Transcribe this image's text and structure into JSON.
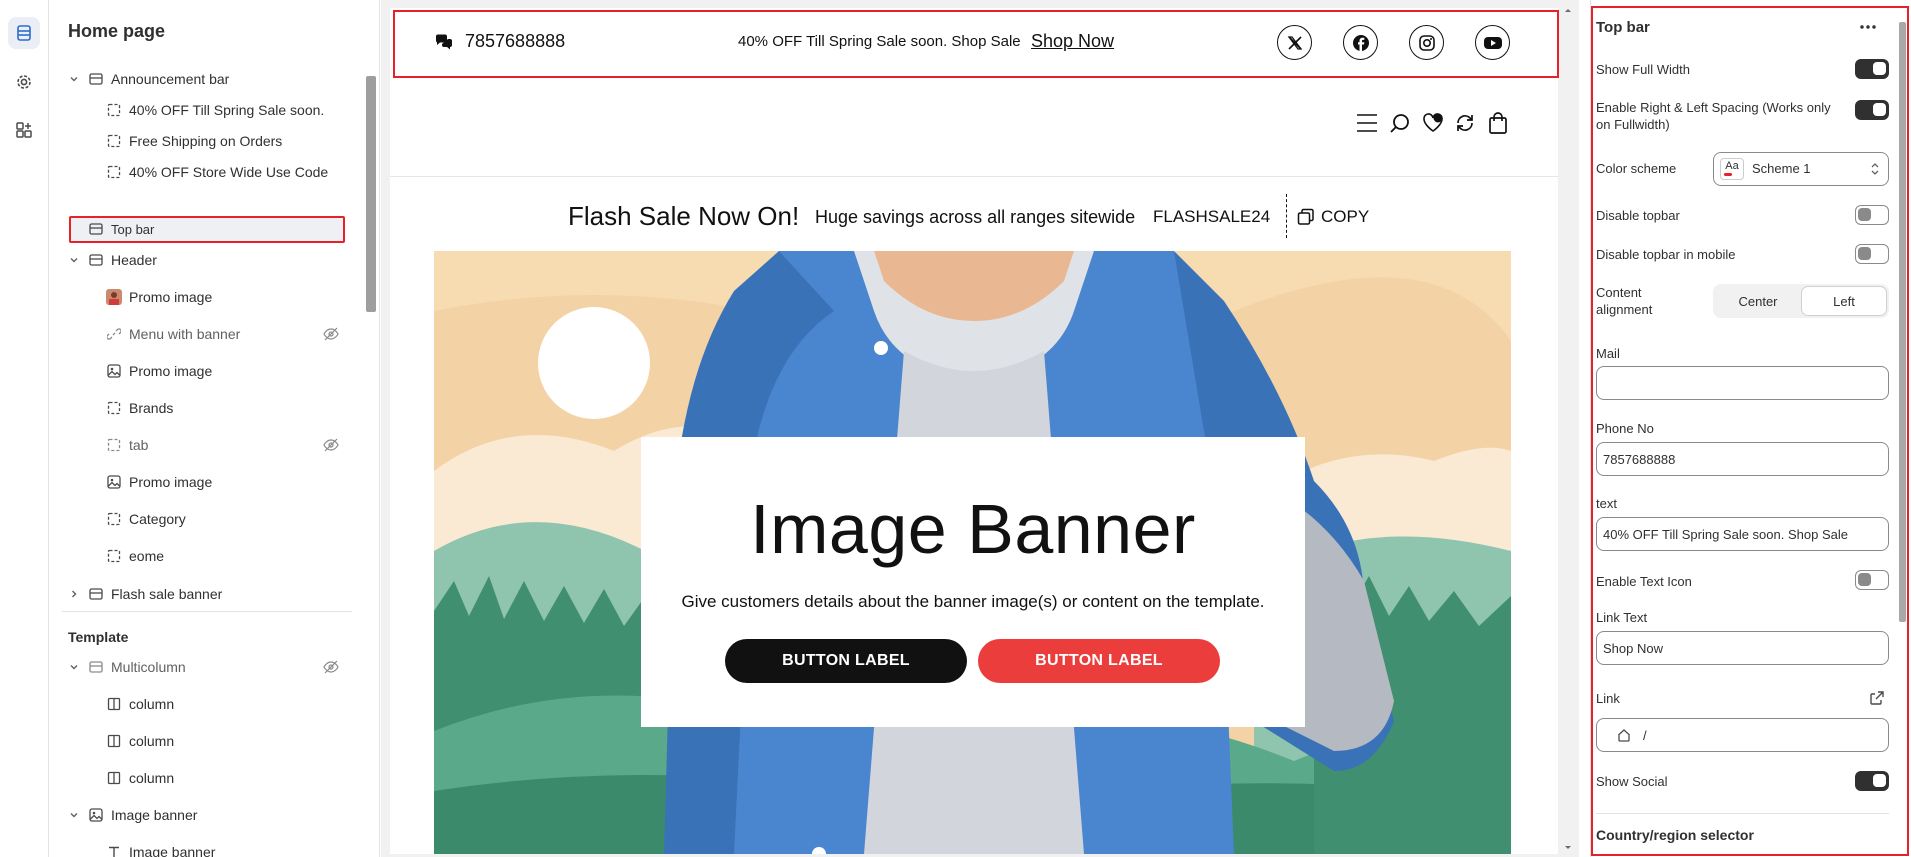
{
  "left_panel": {
    "title": "Home page",
    "items": [
      {
        "label": "Announcement bar"
      },
      {
        "label": "40% OFF Till Spring Sale soon."
      },
      {
        "label": "Free Shipping on Orders"
      },
      {
        "label": "40% OFF Store Wide Use Code"
      },
      {
        "label": "Top bar"
      },
      {
        "label": "Header"
      },
      {
        "label": "Promo image"
      },
      {
        "label": "Menu with banner"
      },
      {
        "label": "Promo image"
      },
      {
        "label": "Brands"
      },
      {
        "label": "tab"
      },
      {
        "label": "Promo image"
      },
      {
        "label": "Category"
      },
      {
        "label": "eome"
      },
      {
        "label": "Flash sale banner"
      }
    ],
    "template_title": "Template",
    "template_items": [
      {
        "label": "Multicolumn"
      },
      {
        "label": "column"
      },
      {
        "label": "column"
      },
      {
        "label": "column"
      },
      {
        "label": "Image banner"
      },
      {
        "label": "Image banner"
      }
    ]
  },
  "preview": {
    "topbar": {
      "phone": "7857688888",
      "text": "40% OFF Till Spring Sale soon. Shop Sale",
      "link": "Shop Now",
      "social": [
        "x-icon",
        "facebook-icon",
        "instagram-icon",
        "youtube-icon"
      ]
    },
    "flash": {
      "title": "Flash Sale Now On!",
      "subtitle": "Huge savings across all ranges sitewide",
      "code": "FLASHSALE24",
      "copy": "COPY"
    },
    "banner": {
      "title": "Image Banner",
      "subtitle": "Give customers details about the banner image(s) or content on the template.",
      "button1": "BUTTON LABEL",
      "button2": "BUTTON LABEL"
    }
  },
  "settings": {
    "title": "Top bar",
    "show_full_width": "Show Full Width",
    "spacing": "Enable Right & Left Spacing (Works only on Fullwidth)",
    "color_scheme": "Color scheme",
    "scheme_value": "Scheme 1",
    "scheme_swatch": "Aa",
    "disable_topbar": "Disable topbar",
    "disable_topbar_mobile": "Disable topbar in mobile",
    "content_alignment": "Content alignment",
    "align_center": "Center",
    "align_left": "Left",
    "mail": "Mail",
    "mail_value": "",
    "phone_label": "Phone No",
    "phone_value": "7857688888",
    "text_label": "text",
    "text_value": "40% OFF Till Spring Sale soon. Shop Sale",
    "enable_text_icon": "Enable Text Icon",
    "link_text_label": "Link Text",
    "link_text_value": "Shop Now",
    "link_label": "Link",
    "link_value": "/",
    "show_social": "Show Social",
    "next_section": "Country/region selector"
  },
  "colors": {
    "accent_red": "#e8202a",
    "button_red": "#ec3d3d",
    "dark": "#111111"
  }
}
